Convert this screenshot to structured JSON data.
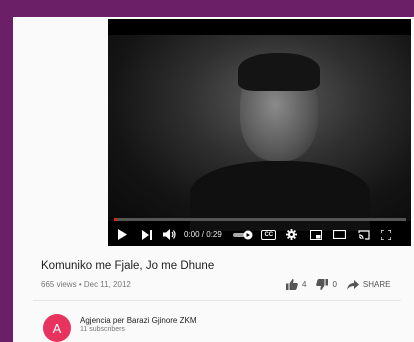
{
  "player": {
    "time_display": "0:00 / 0:29",
    "progress": 0.01,
    "cc_label": "CC"
  },
  "video": {
    "title": "Komuniko me Fjale, Jo me Dhune",
    "views": "665 views",
    "separator": "•",
    "date": "Dec 11, 2012",
    "likes": "4",
    "dislikes": "0",
    "share_label": "SHARE"
  },
  "channel": {
    "avatar_letter": "A",
    "name": "Agjencia per Barazi Gjinore ZKM",
    "subscribers": "11 subscribers",
    "avatar_color": "#e8335e"
  },
  "colors": {
    "frame": "#6a1f66",
    "progress": "#e62117"
  }
}
